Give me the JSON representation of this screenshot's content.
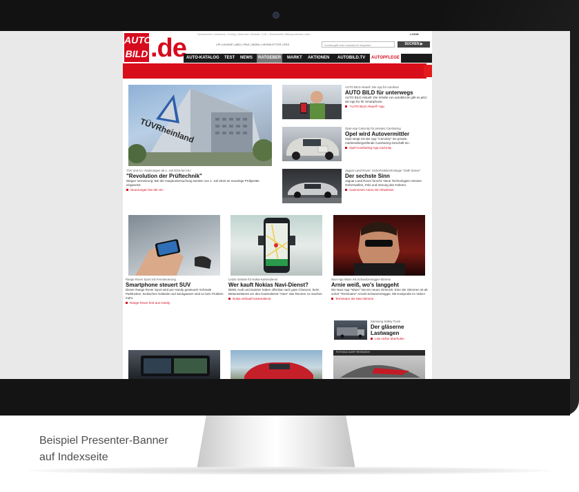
{
  "site": {
    "logo_auto": "AUTO BILD",
    "logo_de": ".de",
    "login": "LOGIN",
    "top_links": "Sportwoche | Autoland | Tuning | Motorrad | Klassik | CXL | Reisemobil | Bikesportnews | abo",
    "service_links": "VIP-LOUNGE | ABO | IPAD | MOBIL | NEWSLETTER | RSS",
    "search_placeholder": "Suchbegriff oder Inserats-ID eingeben",
    "search_button": "SUCHEN ▶",
    "nav": [
      "AUTO-KATALOG",
      "TEST",
      "NEWS",
      "RATGEBER",
      "MARKT",
      "AKTIONEN",
      "AUTOBILD.TV",
      "AUTOPFLEGE"
    ],
    "nav_active": "RATGEBER",
    "accent": "#d60b1d"
  },
  "articles": {
    "main": {
      "image_text": "TÜVRheinland",
      "kicker": "TÜV und Co: Änderungen ab 1. Juli 2015 bei HU",
      "headline": "\"Revolution der Prüftechnik\"",
      "teaser": "Wegen Vernetzung: Bei der Hauptuntersuchung werden von 1. Juli 2015 an neuartige Prüfgeräte eingesetzt.",
      "link": "Neuerungen bei der HU"
    },
    "app": {
      "kicker": "AUTO BILD Aktuell: Die App für Autofans",
      "headline": "AUTO BILD für unterwegs",
      "teaser": "AUTO BILD Aktuell: Die Inhalte von autobild.de gibt es jetzt als App für Ihr Smartphone.",
      "link": "\"AUTO BILD Aktuell\"-App"
    },
    "opel": {
      "kicker": "Opel-App CarUnity für privates Carsharing",
      "headline": "Opel wird Autovermittler",
      "teaser": "Opel steigt mit der App \"CarUnity\" ins private, markenübergreifende Carsharing-Geschäft ein.",
      "link": "Opel-Carsharing-App CarUnity"
    },
    "jaguar": {
      "kicker": "Jaguar Land Rover: Sicherheitstechnologie \"Sixth Sense\"",
      "headline": "Der sechste Sinn",
      "teaser": "Jaguar Land Rover forscht: Neue Technologien messen Gehirnwellen, Puls und Atmung des Fahrers.",
      "link": "Autonomes Autos mit Hinweisen"
    },
    "rangerover": {
      "kicker": "Range Rover Sport mit Fernsteuerung",
      "headline": "Smartphone steuert SUV",
      "teaser": "Dieser Range Rover Sport wird per Handy gesteuert! Schmale Parklücken, tückisches Gelände und Sackgassen sind so kein Problem mehr.",
      "link": "Range Rover hört aus Handy"
    },
    "nokia": {
      "kicker": "Letzte Gebote für Nokia-Kartendienst",
      "headline": "Wer kauft Nokias Navi-Dienst?",
      "teaser": "BMW, Audi und Daimler haben offenbar nach gute Chancen, beim Bieterwettstreit um den Kartendienst \"Here\" das Rennen zu machen.",
      "link": "Nokia verkauft Kartendienst"
    },
    "arnie": {
      "kicker": "Navi-App Waze mit Schwarzenegger-Stimme",
      "headline": "Arnie weiß, wo's langgeht",
      "teaser": "Die Navi-App \"Waze\" hat ein neues Gimmick: Eine der Stimmen ist ab sofort \"Terminator\" Arnold Schwarzenegger. Mit Kostprobe im Video!",
      "link": "Terminator als Navi-Stimme"
    },
    "truck": {
      "kicker": "Samsung Safety Truck",
      "headline": "Der gläserne Lastwagen",
      "link": "Löw sicher überholen"
    },
    "bottom_image_text": "POTHOLE ALERT RESEARCH"
  },
  "caption": {
    "line1": "Beispiel Presenter-Banner",
    "line2": "auf Indexseite"
  }
}
